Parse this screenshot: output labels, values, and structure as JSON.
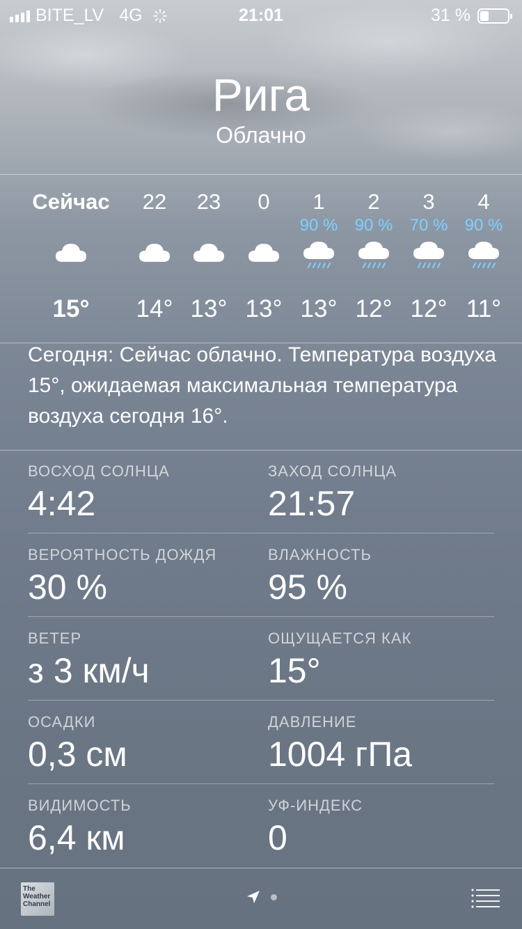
{
  "status_bar": {
    "carrier": "BITE_LV",
    "network": "4G",
    "time": "21:01",
    "battery": "31 %",
    "battery_level": 0.31
  },
  "header": {
    "city": "Рига",
    "condition": "Облачно"
  },
  "hourly": [
    {
      "time": "Сейчас",
      "precip": "",
      "icon": "cloud-icon",
      "temp": "15°",
      "now": true
    },
    {
      "time": "22",
      "precip": "",
      "icon": "cloud-icon",
      "temp": "14°"
    },
    {
      "time": "23",
      "precip": "",
      "icon": "cloud-icon",
      "temp": "13°"
    },
    {
      "time": "0",
      "precip": "",
      "icon": "cloud-icon",
      "temp": "13°"
    },
    {
      "time": "1",
      "precip": "90 %",
      "icon": "rain-cloud-icon",
      "temp": "13°"
    },
    {
      "time": "2",
      "precip": "90 %",
      "icon": "rain-cloud-icon",
      "temp": "12°"
    },
    {
      "time": "3",
      "precip": "70 %",
      "icon": "rain-cloud-icon",
      "temp": "12°"
    },
    {
      "time": "4",
      "precip": "90 %",
      "icon": "rain-cloud-icon",
      "temp": "11°"
    }
  ],
  "summary": {
    "text": "Сегодня: Сейчас облачно. Температура воздуха 15°, ожидаемая максимальная температура воздуха сегодня 16°."
  },
  "details": [
    {
      "left_label": "ВОСХОД СОЛНЦА",
      "left_value": "4:42",
      "right_label": "ЗАХОД СОЛНЦА",
      "right_value": "21:57"
    },
    {
      "left_label": "ВЕРОЯТНОСТЬ ДОЖДЯ",
      "left_value": "30 %",
      "right_label": "ВЛАЖНОСТЬ",
      "right_value": "95 %"
    },
    {
      "left_label": "ВЕТЕР",
      "left_value": "з 3 км/ч",
      "right_label": "ОЩУЩАЕТСЯ КАК",
      "right_value": "15°"
    },
    {
      "left_label": "ОСАДКИ",
      "left_value": "0,3 см",
      "right_label": "ДАВЛЕНИЕ",
      "right_value": "1004 гПа"
    },
    {
      "left_label": "ВИДИМОСТЬ",
      "left_value": "6,4 км",
      "right_label": "УФ-ИНДЕКС",
      "right_value": "0"
    }
  ],
  "bottom_bar": {
    "logo_text": "The Weather Channel"
  },
  "colors": {
    "precip_blue": "#7fd0ff"
  }
}
